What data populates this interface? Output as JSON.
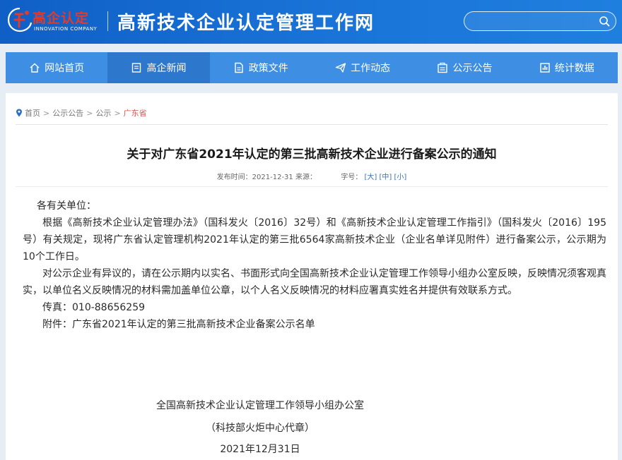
{
  "header": {
    "logo_cn": "高企认定",
    "logo_en": "INNOVATION COMPANY",
    "site_title": "高新技术企业认定管理工作网",
    "search": {
      "value": "",
      "placeholder": ""
    }
  },
  "nav": {
    "items": [
      {
        "label": "网站首页",
        "icon": "home-icon"
      },
      {
        "label": "高企新闻",
        "icon": "news-icon",
        "active": true
      },
      {
        "label": "政策文件",
        "icon": "document-icon"
      },
      {
        "label": "工作动态",
        "icon": "send-icon"
      },
      {
        "label": "公示公告",
        "icon": "announcement-icon"
      },
      {
        "label": "统计数据",
        "icon": "chart-icon"
      }
    ]
  },
  "breadcrumb": {
    "items": [
      "首页",
      "公示公告",
      "公示",
      "广东省"
    ],
    "separator": ">"
  },
  "article": {
    "title": "关于对广东省2021年认定的第三批高新技术企业进行备案公示的通知",
    "meta": {
      "publish_label": "发布时间：",
      "publish_date": "2021-12-31",
      "source_label": "来源：",
      "font_label": "字号：",
      "font_large": "[大]",
      "font_medium": "[中]",
      "font_small": "[小]"
    },
    "salutation": "各有关单位：",
    "paragraphs": [
      "根据《高新技术企业认定管理办法》（国科发火〔2016〕32号）和《高新技术企业认定管理工作指引》（国科发火〔2016〕195号）有关规定，现将广东省认定管理机构2021年认定的第三批6564家高新技术企业（企业名单详见附件）进行备案公示，公示期为10个工作日。",
      "对公示企业有异议的，请在公示期内以实名、书面形式向全国高新技术企业认定管理工作领导小组办公室反映，反映情况须客观真实，以单位名义反映情况的材料需加盖单位公章，以个人名义反映情况的材料应署真实姓名并提供有效联系方式。"
    ],
    "fax": "传真：010-88656259",
    "attachment": "附件：广东省2021年认定的第三批高新技术企业备案公示名单",
    "signature": {
      "org": "全国高新技术企业认定管理工作领导小组办公室",
      "note": "（科技部火炬中心代章）",
      "date": "2021年12月31日"
    }
  },
  "colors": {
    "header_blue": "#1a74d8",
    "nav_blue": "#3e8fe4",
    "nav_active": "#2d77cd",
    "logo_red": "#e23a2b",
    "breadcrumb_current": "#d9534f",
    "page_bg": "#e7edf5"
  }
}
